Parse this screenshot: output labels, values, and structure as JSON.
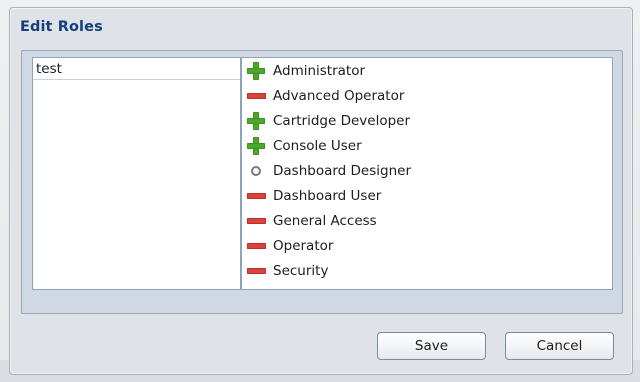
{
  "dialog": {
    "title": "Edit Roles"
  },
  "names": [
    {
      "label": "test"
    }
  ],
  "roles": [
    {
      "label": "Administrator",
      "state": "plus",
      "icon": "green-plus-icon"
    },
    {
      "label": "Advanced Operator",
      "state": "minus",
      "icon": "red-minus-icon"
    },
    {
      "label": "Cartridge Developer",
      "state": "plus",
      "icon": "green-plus-icon"
    },
    {
      "label": "Console User",
      "state": "plus",
      "icon": "green-plus-icon"
    },
    {
      "label": "Dashboard Designer",
      "state": "circle",
      "icon": "gray-circle-icon"
    },
    {
      "label": "Dashboard User",
      "state": "minus",
      "icon": "red-minus-icon"
    },
    {
      "label": "General Access",
      "state": "minus",
      "icon": "red-minus-icon"
    },
    {
      "label": "Operator",
      "state": "minus",
      "icon": "red-minus-icon"
    },
    {
      "label": "Security",
      "state": "minus",
      "icon": "red-minus-icon"
    }
  ],
  "buttons": {
    "save": "Save",
    "cancel": "Cancel"
  },
  "colors": {
    "title": "#163e7a",
    "plus": "#4aa82a",
    "minus": "#d9443a",
    "circle": "#7a7a7a"
  }
}
